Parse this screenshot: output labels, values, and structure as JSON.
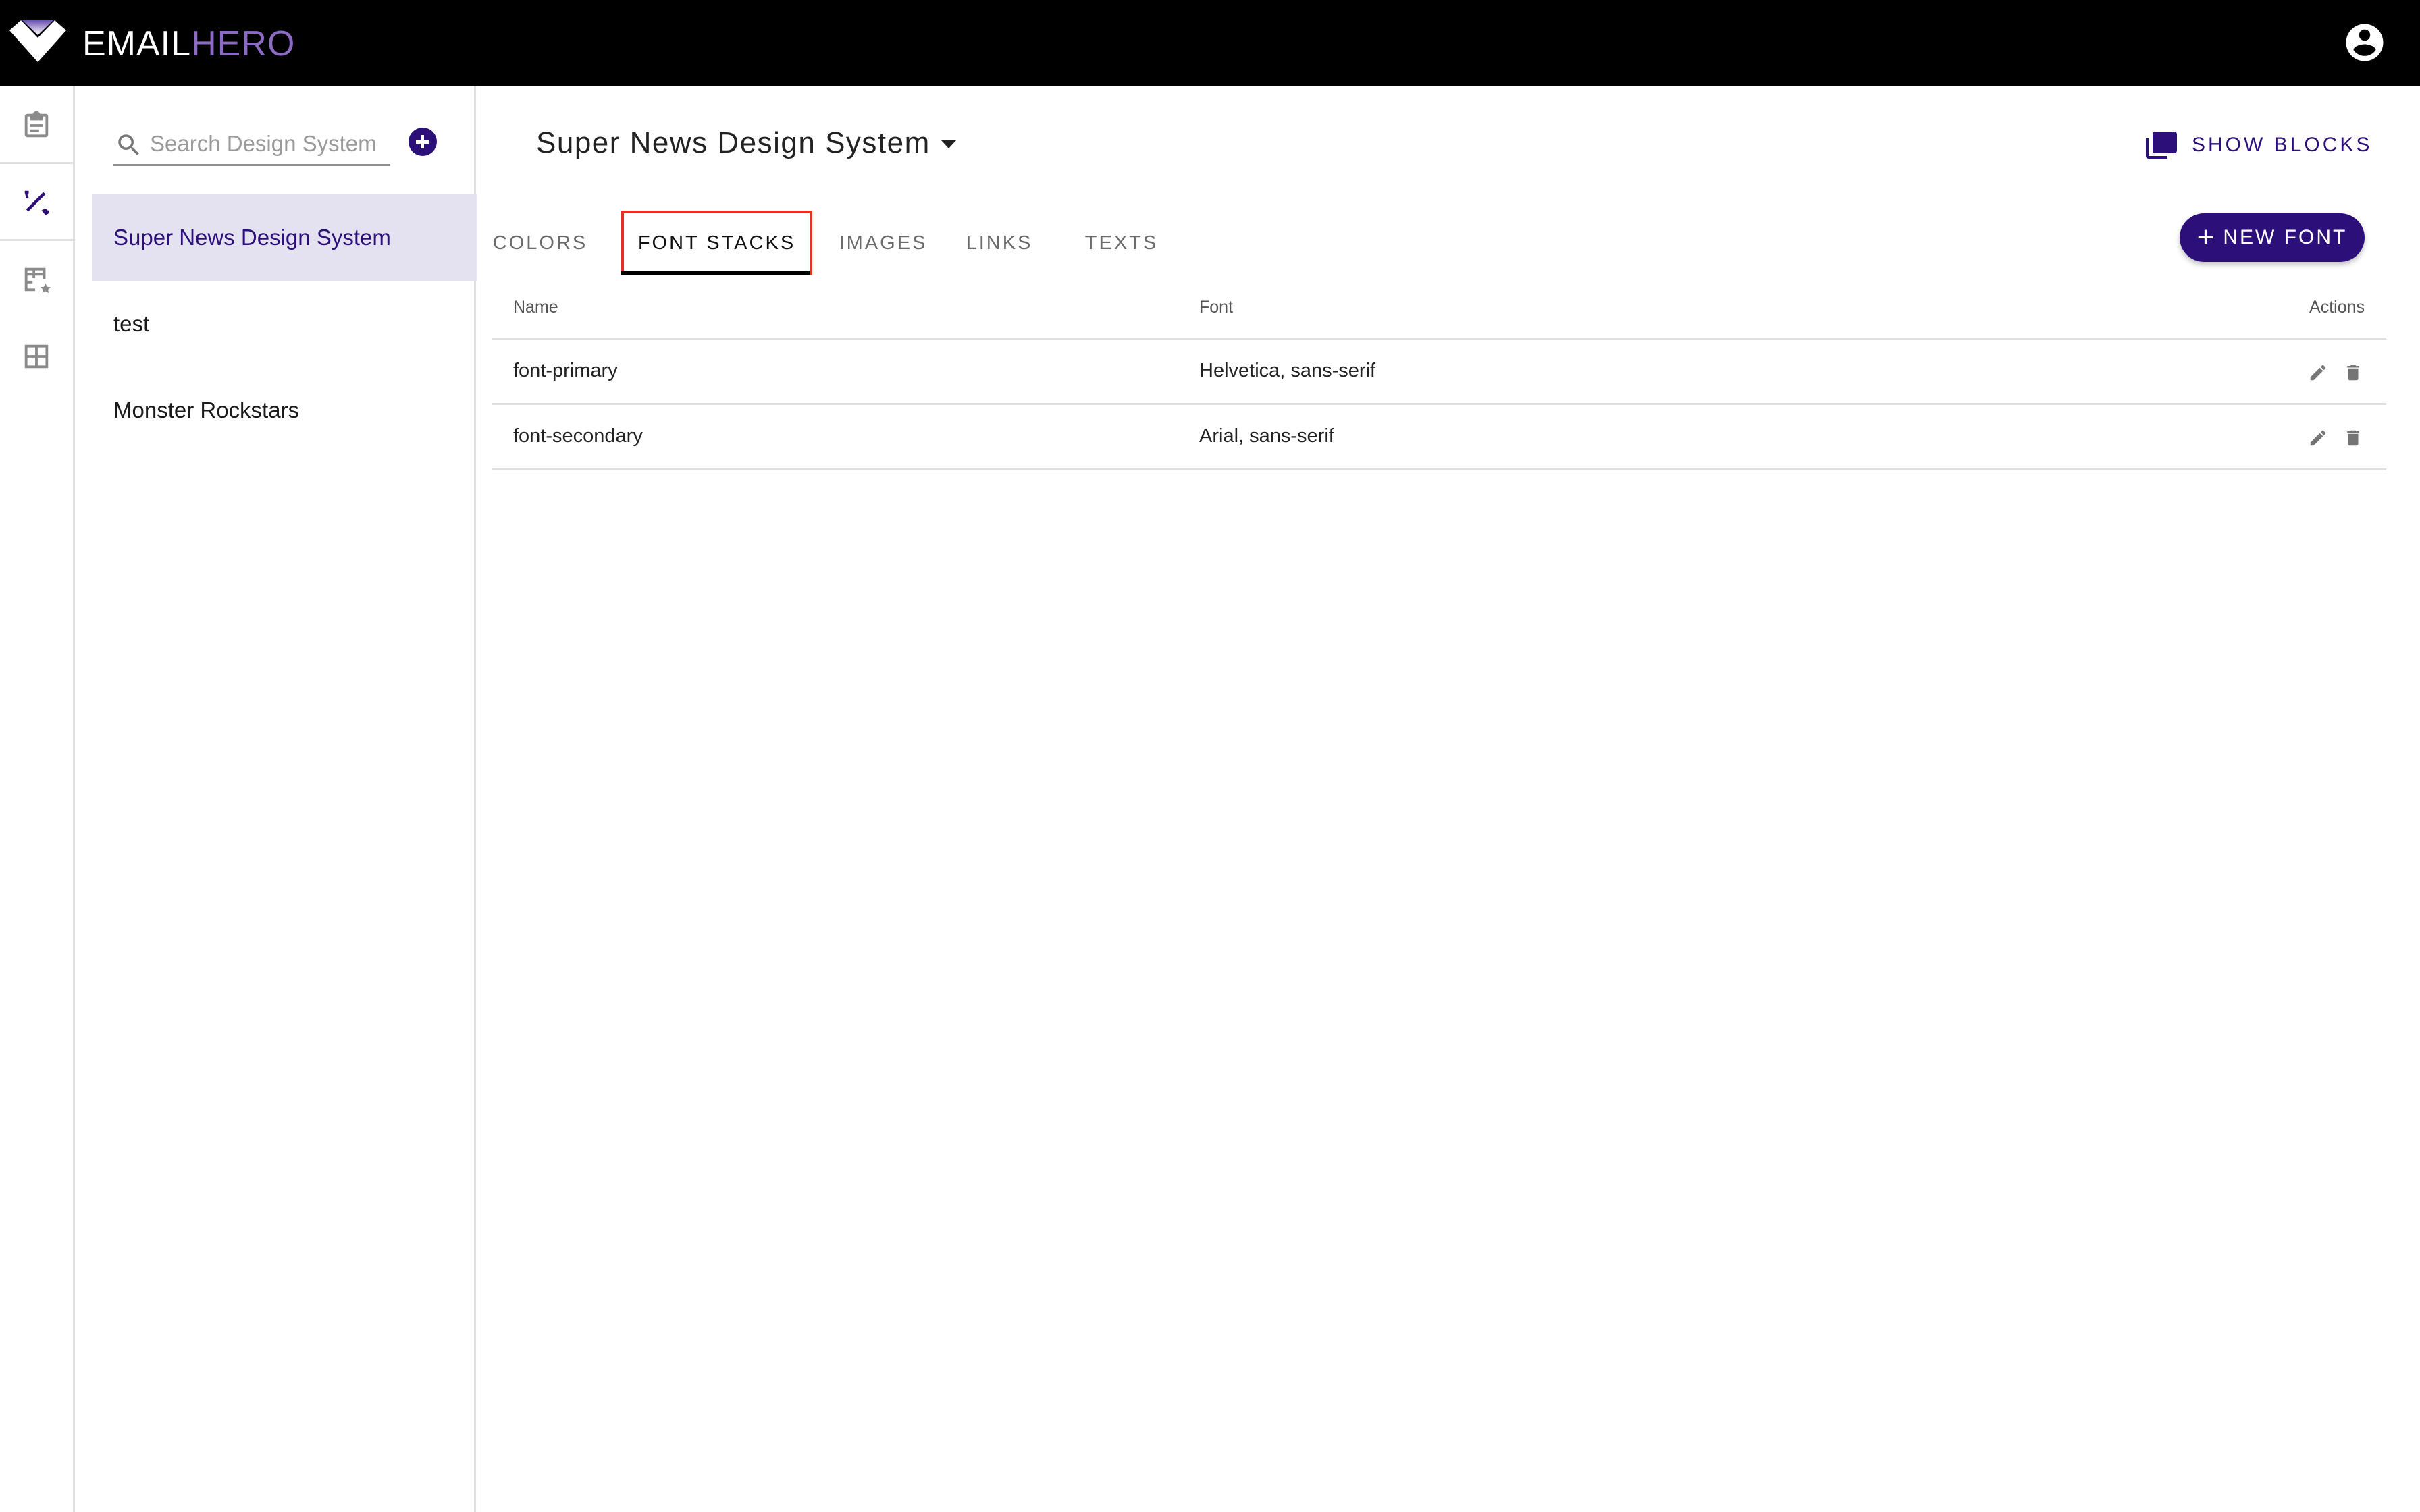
{
  "app": {
    "brand_part1": "EMAIL",
    "brand_part2": "HERO",
    "brand_color": "#8c6bc4",
    "accent_color": "#2d0f7a"
  },
  "rail": {
    "items": [
      {
        "icon": "clipboard-icon",
        "active": false
      },
      {
        "icon": "design-tools-icon",
        "active": true
      },
      {
        "icon": "table-star-icon",
        "active": false
      },
      {
        "icon": "grid-icon",
        "active": false
      }
    ]
  },
  "list_panel": {
    "search_placeholder": "Search Design System",
    "search_value": "",
    "items": [
      {
        "label": "Super News Design System",
        "selected": true
      },
      {
        "label": "test",
        "selected": false
      },
      {
        "label": "Monster Rockstars",
        "selected": false
      }
    ]
  },
  "main": {
    "title": "Super News Design System",
    "show_blocks_label": "SHOW BLOCKS",
    "tabs": [
      {
        "label": "COLORS",
        "active": false
      },
      {
        "label": "FONT STACKS",
        "active": true
      },
      {
        "label": "IMAGES",
        "active": false
      },
      {
        "label": "LINKS",
        "active": false
      },
      {
        "label": "TEXTS",
        "active": false
      }
    ],
    "new_button_label": "NEW FONT",
    "table": {
      "columns": [
        "Name",
        "Font",
        "Actions"
      ],
      "rows": [
        {
          "name": "font-primary",
          "font": "Helvetica, sans-serif"
        },
        {
          "name": "font-secondary",
          "font": "Arial, sans-serif"
        }
      ]
    }
  }
}
